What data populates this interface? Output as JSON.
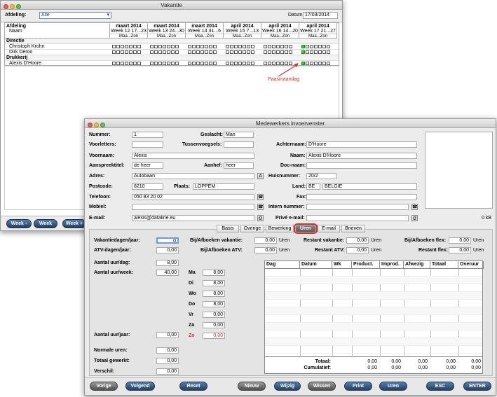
{
  "vak": {
    "title": "Vakantie",
    "afd_label": "Afdeling:",
    "afd_value": "Alle",
    "datum_label": "Datum:",
    "datum_value": "17/03/2014",
    "col1": "Afdeling",
    "col1b": "Naam",
    "weeks": [
      {
        "m": "maart 2014",
        "w": "Week 12  17...23"
      },
      {
        "m": "maart 2014",
        "w": "Week 13  24...30"
      },
      {
        "m": "maart 2014",
        "w": "Week 14  31...6"
      },
      {
        "m": "april 2014",
        "w": "Week 15  7...13"
      },
      {
        "m": "april 2014",
        "w": "Week 16  14...20"
      },
      {
        "m": "april 2014",
        "w": "Week 17  21...27"
      }
    ],
    "daylabel": "Maa...Zon",
    "rows": [
      {
        "t": "Directie",
        "h": true
      },
      {
        "t": "Christoph Krohn"
      },
      {
        "t": "Dirk Deroo"
      },
      {
        "t": "Drukkerij",
        "h": true
      },
      {
        "t": "Alexis D'Hoore"
      }
    ],
    "btn_prev": "Week -",
    "btn_week": "Week",
    "btn_next": "Week +",
    "annotation": "Paasmaandag"
  },
  "mw": {
    "title": "Medewerkers invoervenster",
    "f": {
      "nummer": "Nummer:",
      "nummer_v": "1",
      "geslacht": "Geslacht:",
      "geslacht_v": "Man",
      "voorletters": "Voorletters:",
      "tussen": "Tussenvoegsels:",
      "achternaam": "Achternaam:",
      "achternaam_v": "D'Hoore",
      "voornaam": "Voornaam:",
      "voornaam_v": "Alexis",
      "naam": "Naam:",
      "naam_v": "Alexis D'Hoore",
      "aansp": "Aanspreektitel:",
      "aansp_v": "de heer",
      "aanhef": "Aanhef:",
      "aanhef_v": "heer",
      "docnaam": "Doc-naam:",
      "adres": "Adres:",
      "adres_v": "Autobaan",
      "huisnr": "Huisnummer:",
      "huisnr_v": "20/2",
      "postcode": "Postcode:",
      "postcode_v": "8210",
      "plaats": "Plaats:",
      "plaats_v": "LOPPEM",
      "land": "Land:",
      "land_code": "BE",
      "land_v": "BELGIË",
      "telefoon": "Telefoon:",
      "telefoon_v": "050 83 20 02",
      "fax": "Fax:",
      "mobiel": "Mobiel:",
      "intern": "Intern nummer:",
      "email": "E-mail:",
      "email_v": "alexis@dataline.eu",
      "prive": "Privé e-mail:",
      "size": "0 kB"
    },
    "tabs": [
      "Basis",
      "Overige",
      "Bewerking",
      "Uren",
      "E-mail",
      "Brieven"
    ],
    "u": {
      "vdj": "Vakantiedagen/jaar:",
      "vdj_v": "0",
      "atv": "ATV-dagen/jaar:",
      "atv_v": "0,00",
      "aud": "Aantal uur/dag:",
      "aud_v": "8,00",
      "auw": "Aantal uur/week:",
      "auw_v": "40,00",
      "auj": "Aantal uur/jaar:",
      "auj_v": "0,00",
      "nu": "Normale uren:",
      "nu_v": "0,00",
      "tg": "Totaal gewerkt:",
      "tg_v": "0,00",
      "vs": "Verschil:",
      "vs_v": "0,00",
      "bav": "Bij/Afboeken vakantie:",
      "bav_v": "0,00",
      "uren": "Uren",
      "batv": "Bij/Afboeken ATV:",
      "batv_v": "0,00",
      "rv": "Restant vakantie:",
      "rv_v": "0,00",
      "ratv": "Restant ATV:",
      "ratv_v": "0,00",
      "baf": "Bij/Afboeken flex:",
      "baf_v": "0,00",
      "rf": "Restant flex:",
      "rf_v": "0,00"
    },
    "days": [
      {
        "d": "Ma",
        "v": "8,00"
      },
      {
        "d": "Di",
        "v": "8,00"
      },
      {
        "d": "Wo",
        "v": "8,00"
      },
      {
        "d": "Do",
        "v": "8,00"
      },
      {
        "d": "Vr",
        "v": "0,00"
      },
      {
        "d": "Za",
        "v": "0,00"
      },
      {
        "d": "Zo",
        "v": "0,00",
        "red": true
      }
    ],
    "grid_cols": [
      "Dag",
      "Datum",
      "Wk",
      "Product.",
      "Improd.",
      "Afwezig",
      "Totaal",
      "Overuur"
    ],
    "totaal": "Totaal:",
    "cumul": "Cumulatief:",
    "zeros": [
      "0,00",
      "0,00",
      "0,00",
      "0,00",
      "0,00"
    ],
    "buttons": [
      "Vorige",
      "Volgend",
      "Reset",
      "Nieuw",
      "Wijzig",
      "Wissen",
      "Print",
      "Uren",
      "ESC",
      "ENTER"
    ]
  },
  "colors": {
    "accent": "#2f5b8f",
    "green": "#2fd12f",
    "highlight": "#d9302a"
  }
}
